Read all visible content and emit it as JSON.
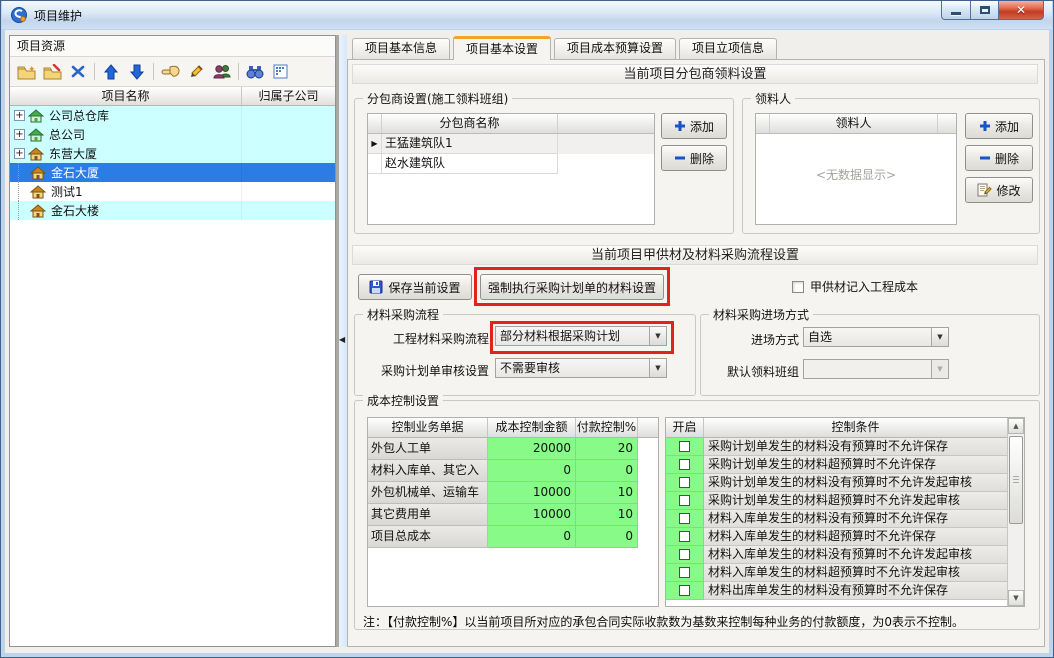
{
  "window": {
    "title": "项目维护",
    "controls": {
      "minimize": "minimize",
      "maximize": "maximize",
      "close": "close"
    }
  },
  "colors": {
    "tab_accent_orange": "#F0A42C",
    "selection_blue": "#2C7CE5",
    "tree_row_cyan": "#CCFFFF",
    "grid_cell_green": "#87FA87",
    "annotation_red": "#E0241A",
    "close_button_red": "#C33A22"
  },
  "left_panel": {
    "title": "项目资源",
    "toolbar_groups": [
      [
        "add-folder-icon",
        "edit-folder-icon",
        "delete-icon"
      ],
      [
        "move-up-icon",
        "move-down-icon"
      ],
      [
        "assign-icon",
        "rename-icon",
        "users-icon"
      ],
      [
        "find-icon",
        "columns-icon"
      ]
    ],
    "tree": {
      "columns": [
        "项目名称",
        "归属子公司"
      ],
      "rows": [
        {
          "name": "公司总仓库",
          "company": "",
          "level": 0,
          "expandable": true,
          "icon": "house-green-icon",
          "bg": "#CCFFFF",
          "selected": false
        },
        {
          "name": "总公司",
          "company": "",
          "level": 0,
          "expandable": true,
          "icon": "house-green-icon",
          "bg": "#CCFFFF",
          "selected": false
        },
        {
          "name": "东营大厦",
          "company": "",
          "level": 0,
          "expandable": true,
          "icon": "house-yellow-icon",
          "bg": "#CCFFFF",
          "selected": false
        },
        {
          "name": "金石大厦",
          "company": "",
          "level": 1,
          "expandable": false,
          "icon": "house-yellow-icon",
          "bg": "#2C7CE5",
          "selected": true
        },
        {
          "name": "测试1",
          "company": "",
          "level": 1,
          "expandable": false,
          "icon": "house-yellow-icon",
          "bg": "#FFFFFF",
          "selected": false
        },
        {
          "name": "金石大楼",
          "company": "",
          "level": 1,
          "expandable": false,
          "icon": "house-yellow-icon",
          "bg": "#CCFFFF",
          "selected": false
        }
      ]
    }
  },
  "tabs": {
    "items": [
      "项目基本信息",
      "项目基本设置",
      "项目成本预算设置",
      "项目立项信息"
    ],
    "active_index": 1
  },
  "picking_section": {
    "title": "当前项目分包商领料设置",
    "subcontractor_group": {
      "legend": "分包商设置(施工领料班组)",
      "column": "分包商名称",
      "rows": [
        "王猛建筑队1",
        "赵水建筑队"
      ],
      "current_row_index": 0,
      "buttons": [
        {
          "label": "添加",
          "icon": "plus-icon"
        },
        {
          "label": "删除",
          "icon": "minus-icon"
        }
      ]
    },
    "picker_group": {
      "legend": "领料人",
      "column": "领料人",
      "empty_text": "<无数据显示>",
      "buttons": [
        {
          "label": "添加",
          "icon": "plus-icon"
        },
        {
          "label": "删除",
          "icon": "minus-icon"
        },
        {
          "label": "修改",
          "icon": "modify-icon"
        }
      ]
    }
  },
  "procurement_section": {
    "title": "当前项目甲供材及材料采购流程设置",
    "save_button": "保存当前设置",
    "force_button": "强制执行采购计划单的材料设置",
    "owner_material_checkbox": {
      "label": "甲供材记入工程成本",
      "checked": false
    },
    "flow_group": {
      "legend": "材料采购流程",
      "fields": [
        {
          "label": "工程材料采购流程",
          "value": "部分材料根据采购计划",
          "highlighted": true
        },
        {
          "label": "采购计划单审核设置",
          "value": "不需要审核",
          "highlighted": false
        }
      ]
    },
    "entry_group": {
      "legend": "材料采购进场方式",
      "fields": [
        {
          "label": "进场方式",
          "value": "自选",
          "disabled": false
        },
        {
          "label": "默认领料班组",
          "value": "",
          "disabled": true
        }
      ]
    }
  },
  "cost_section": {
    "legend": "成本控制设置",
    "cost_table": {
      "columns": [
        "控制业务单据",
        "成本控制金额",
        "付款控制%"
      ],
      "rows": [
        {
          "doc": "外包人工单",
          "amount": "20000",
          "pay": "20"
        },
        {
          "doc": "材料入库单、其它入",
          "amount": "0",
          "pay": "0"
        },
        {
          "doc": "外包机械单、运输车",
          "amount": "10000",
          "pay": "10"
        },
        {
          "doc": "其它费用单",
          "amount": "10000",
          "pay": "10"
        },
        {
          "doc": "项目总成本",
          "amount": "0",
          "pay": "0"
        }
      ]
    },
    "condition_table": {
      "columns": [
        "开启",
        "控制条件"
      ],
      "rows": [
        {
          "checked": false,
          "text": "采购计划单发生的材料没有预算时不允许保存"
        },
        {
          "checked": false,
          "text": "采购计划单发生的材料超预算时不允许保存"
        },
        {
          "checked": false,
          "text": "采购计划单发生的材料没有预算时不允许发起审核"
        },
        {
          "checked": false,
          "text": "采购计划单发生的材料超预算时不允许发起审核"
        },
        {
          "checked": false,
          "text": "材料入库单发生的材料没有预算时不允许保存"
        },
        {
          "checked": false,
          "text": "材料入库单发生的材料超预算时不允许保存"
        },
        {
          "checked": false,
          "text": "材料入库单发生的材料没有预算时不允许发起审核"
        },
        {
          "checked": false,
          "text": "材料入库单发生的材料超预算时不允许发起审核"
        },
        {
          "checked": false,
          "text": "材料出库单发生的材料没有预算时不允许保存"
        }
      ]
    },
    "note": "注：【付款控制%】以当前项目所对应的承包合同实际收款数为基数来控制每种业务的付款额度，为0表示不控制。"
  }
}
